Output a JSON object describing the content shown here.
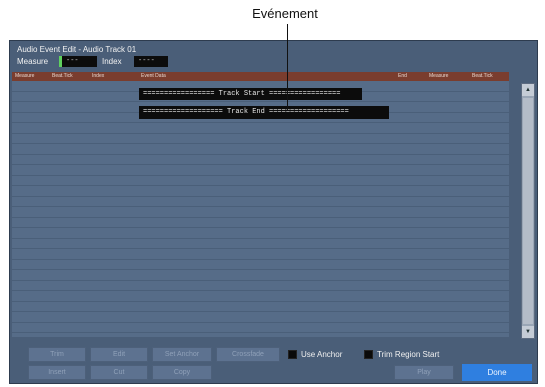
{
  "callout": {
    "label": "Evénement"
  },
  "screen": {
    "title": "Audio Event Edit - Audio Track 01",
    "measure_label": "Measure",
    "measure_value": "---",
    "index_label": "Index",
    "index_value": "----"
  },
  "columns": [
    "Measure",
    "Beat.Tick",
    "Index",
    "Event Data",
    "End",
    "Measure",
    "Beat.Tick"
  ],
  "events": {
    "track_start": "================= Track Start =================",
    "track_end": "=================== Track End ==================="
  },
  "buttons": {
    "row1": [
      "Trim",
      "Edit",
      "Set Anchor",
      "Crossfade"
    ],
    "row2": [
      "Insert",
      "Cut",
      "Copy"
    ],
    "use_anchor": "Use Anchor",
    "trim_region_start": "Trim Region Start",
    "play": "Play",
    "done": "Done"
  },
  "colors": {
    "screen_bg": "#4a5e78",
    "header_bg": "#7a3d2e",
    "done_bg": "#2f7fe0",
    "measure_indicator": "#5fd05f"
  }
}
